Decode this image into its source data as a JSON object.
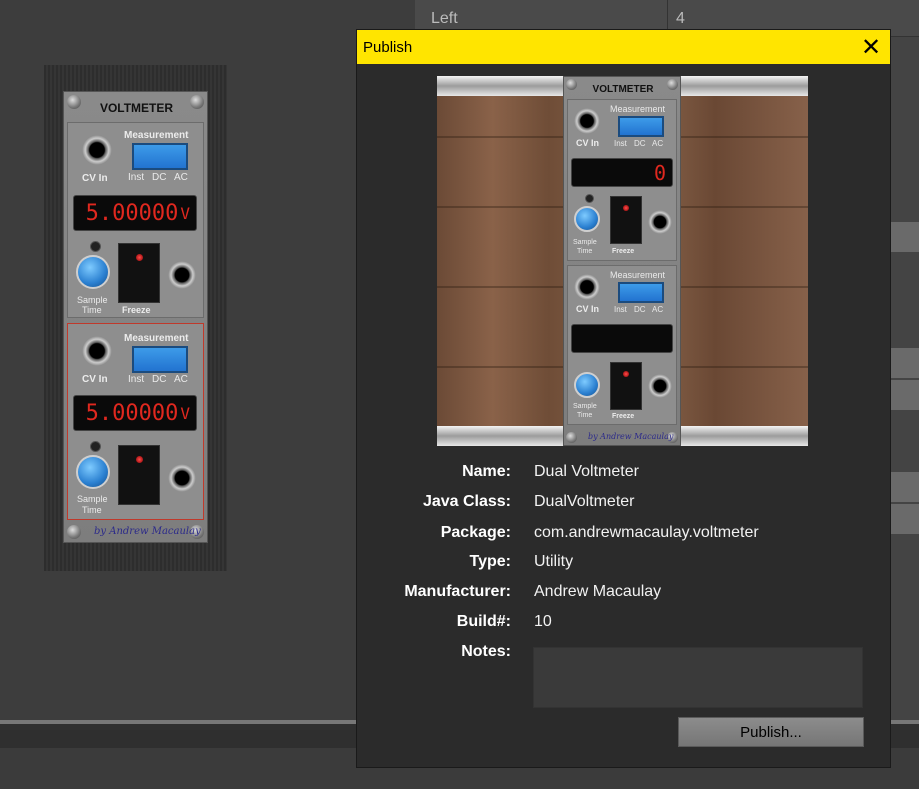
{
  "background": {
    "row_label": "Left",
    "row_value": "4"
  },
  "module": {
    "title": "VOLTMETER",
    "cv_in_label": "CV In",
    "measurement_label": "Measurement",
    "mode_inst": "Inst",
    "mode_dc": "DC",
    "mode_ac": "AC",
    "sample_label": "Sample",
    "time_label": "Time",
    "freeze_label": "Freeze",
    "signature": "by Andrew Macaulay",
    "reading_1": "5.00000",
    "reading_2": "5.00000",
    "unit": "V",
    "preview_reading_1": "0",
    "preview_reading_2": ""
  },
  "dialog": {
    "title": "Publish",
    "close_glyph": "✕",
    "fields": [
      {
        "label": "Name:",
        "value": "Dual Voltmeter"
      },
      {
        "label": "Java Class:",
        "value": "DualVoltmeter"
      },
      {
        "label": "Package:",
        "value": "com.andrewmacaulay.voltmeter"
      },
      {
        "label": "Type:",
        "value": "Utility"
      },
      {
        "label": "Manufacturer:",
        "value": "Andrew Macaulay"
      },
      {
        "label": "Build#:",
        "value": "10"
      },
      {
        "label": "Notes:",
        "value": ""
      }
    ],
    "publish_button": "Publish..."
  },
  "colors": {
    "titlebar": "#ffe500",
    "display_digits": "#e0281f",
    "measurement_button": "#2a85dd"
  }
}
